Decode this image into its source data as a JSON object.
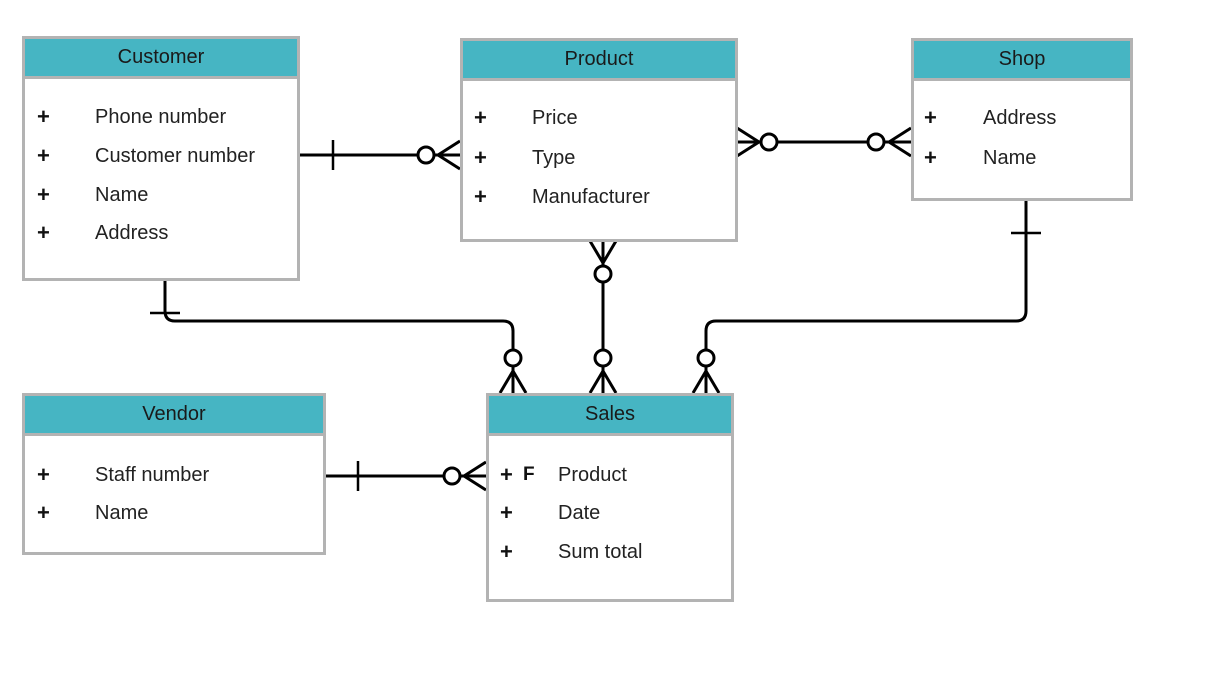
{
  "entities": {
    "customer": {
      "title": "Customer",
      "attributes": [
        "Phone number",
        "Customer number",
        "Name",
        "Address"
      ]
    },
    "product": {
      "title": "Product",
      "attributes": [
        "Price",
        "Type",
        "Manufacturer"
      ]
    },
    "shop": {
      "title": "Shop",
      "attributes": [
        "Address",
        "Name"
      ]
    },
    "vendor": {
      "title": "Vendor",
      "attributes": [
        "Staff number",
        "Name"
      ]
    },
    "sales": {
      "title": "Sales",
      "attributes": [
        "Product",
        "Date",
        "Sum total"
      ],
      "fk_marker": "F"
    }
  },
  "key_marker": "+",
  "relationships": [
    {
      "from": "Customer",
      "to": "Product",
      "from_card": "one",
      "to_card": "zero-or-many"
    },
    {
      "from": "Product",
      "to": "Shop",
      "from_card": "zero-or-many",
      "to_card": "zero-or-many"
    },
    {
      "from": "Product",
      "to": "Sales",
      "from_card": "zero-or-many",
      "to_card": "zero-or-many"
    },
    {
      "from": "Customer",
      "to": "Sales",
      "from_card": "one",
      "to_card": "zero-or-many"
    },
    {
      "from": "Shop",
      "to": "Sales",
      "from_card": "one",
      "to_card": "zero-or-many"
    },
    {
      "from": "Vendor",
      "to": "Sales",
      "from_card": "one",
      "to_card": "zero-or-many"
    }
  ],
  "colors": {
    "header": "#46b5c3",
    "border": "#b3b3b3",
    "line": "#000000"
  }
}
